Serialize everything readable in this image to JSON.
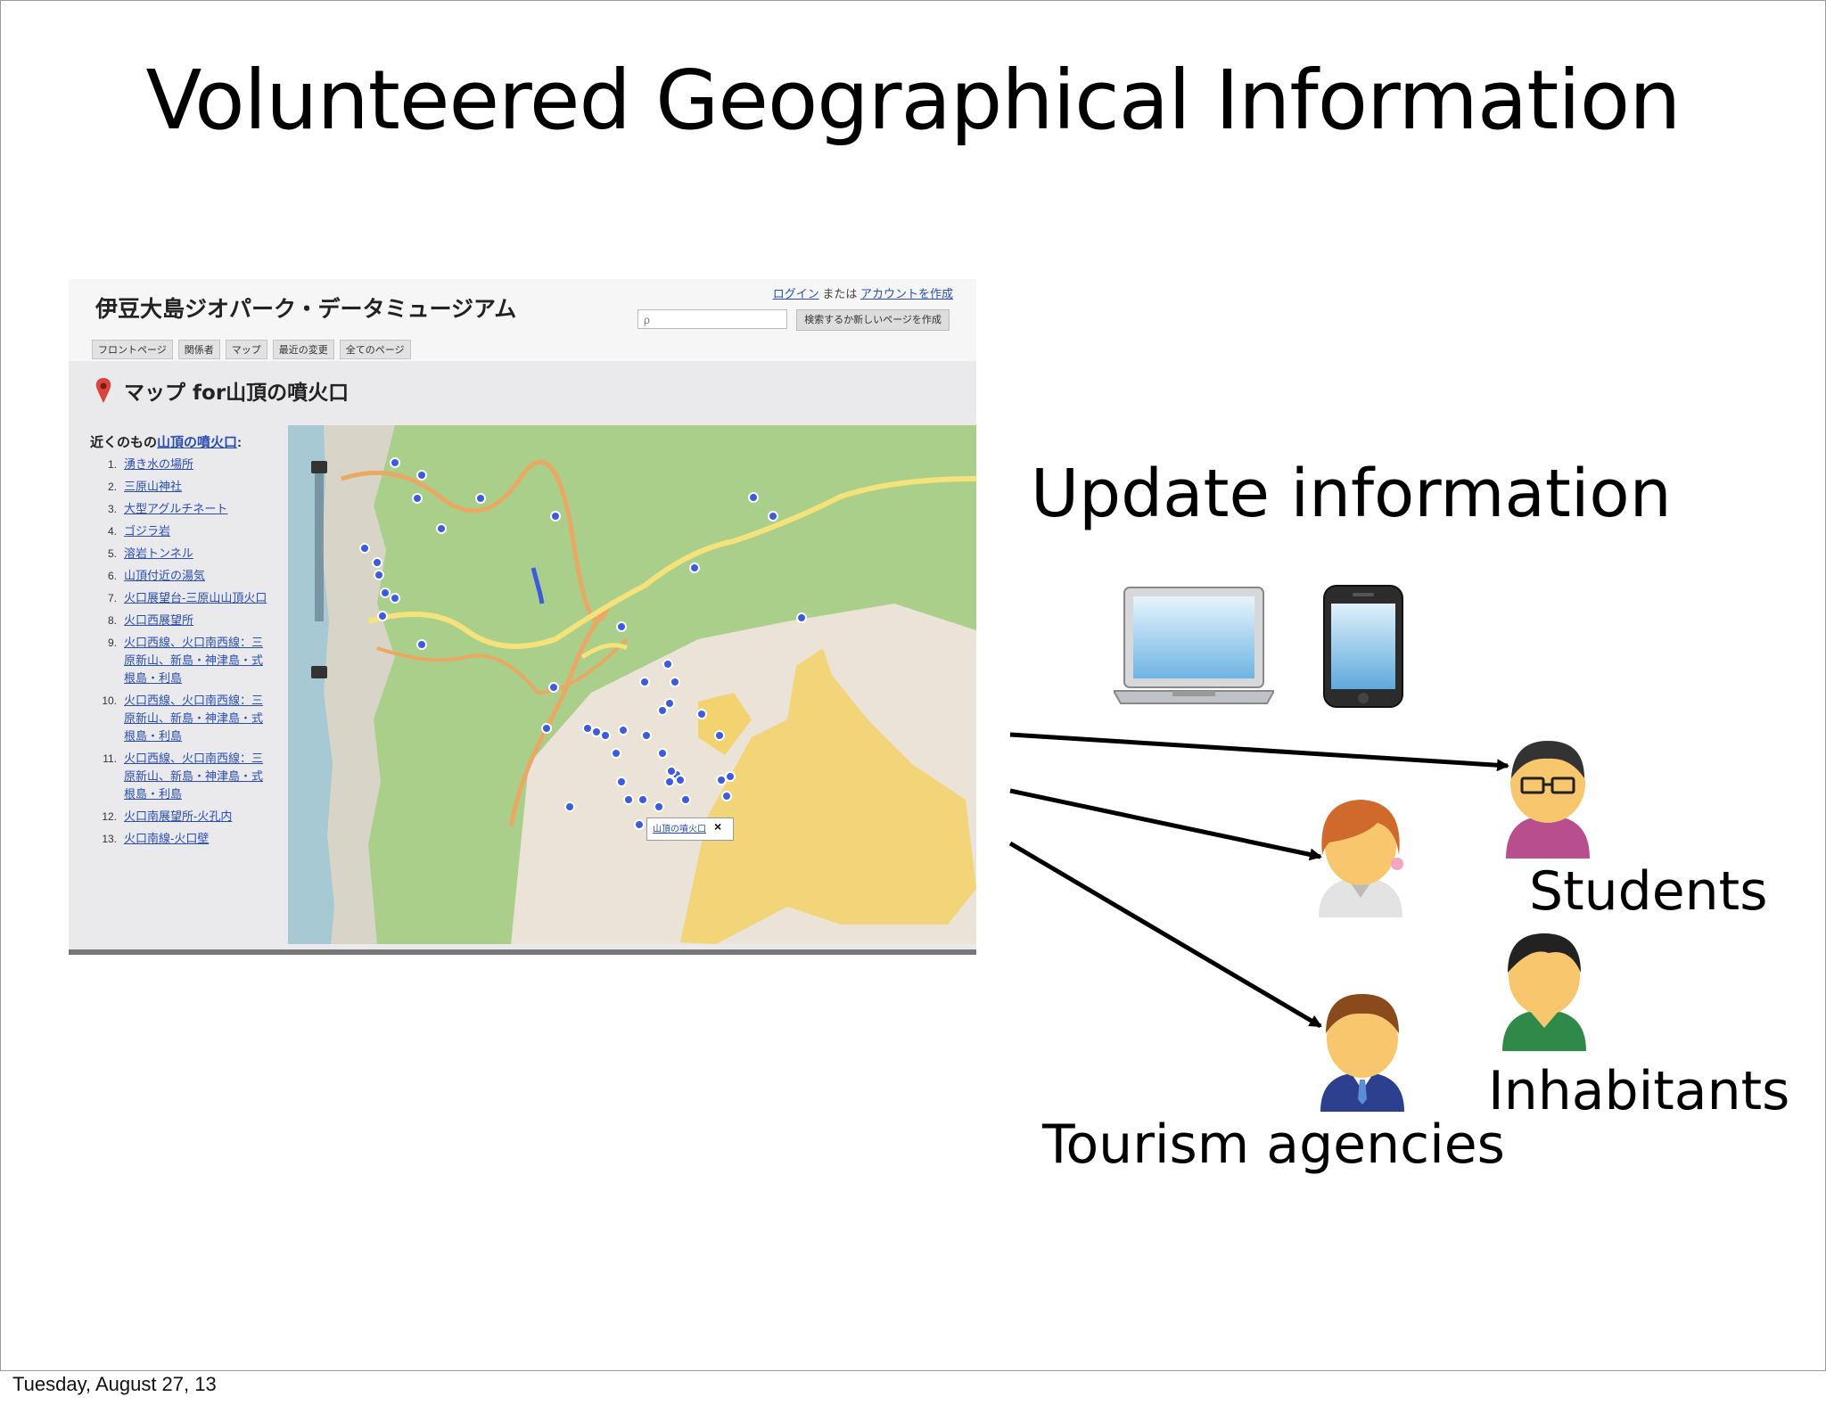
{
  "slide": {
    "title": "Volunteered Geographical Information",
    "footer_date": "Tuesday, August 27, 13"
  },
  "screenshot": {
    "wiki_title": "伊豆大島ジオパーク・データミュージアム",
    "login_link": "ログイン",
    "login_or": "または",
    "create_account_link": "アカウントを作成",
    "search_placeholder": "ρ",
    "search_button": "検索するか新しいページを作成",
    "nav_tabs": [
      "フロントページ",
      "関係者",
      "マップ",
      "最近の変更",
      "全てのページ"
    ],
    "page_heading": "マップ for山頂の噴火口",
    "nearby_prefix": "近くのもの",
    "nearby_link": "山頂の噴火口",
    "nearby_suffix": ":",
    "nearby_items": [
      {
        "num": "1.",
        "label": "湧き水の場所"
      },
      {
        "num": "2.",
        "label": "三原山神社"
      },
      {
        "num": "3.",
        "label": "大型アグルチネート"
      },
      {
        "num": "4.",
        "label": "ゴジラ岩"
      },
      {
        "num": "5.",
        "label": "溶岩トンネル"
      },
      {
        "num": "6.",
        "label": "山頂付近の湯気"
      },
      {
        "num": "7.",
        "label": "火口展望台-三原山山頂火口"
      },
      {
        "num": "8.",
        "label": "火口西展望所"
      },
      {
        "num": "9.",
        "label": "火口西線、火口南西線：三原新山、新島・神津島・式根島・利島"
      },
      {
        "num": "10.",
        "label": "火口西線、火口南西線：三原新山、新島・神津島・式根島・利島"
      },
      {
        "num": "11.",
        "label": "火口西線、火口南西線：三原新山、新島・神津島・式根島・利島"
      },
      {
        "num": "12.",
        "label": "火口南展望所-火孔内"
      },
      {
        "num": "13.",
        "label": "火口南線-火口壁"
      }
    ],
    "map_popup_label": "山頂の噴火口",
    "map_popup_close": "×"
  },
  "diagram": {
    "update_label": "Update information",
    "students_label": "Students",
    "inhabitants_label": "Inhabitants",
    "tourism_label": "Tourism agencies",
    "devices": [
      "laptop-icon",
      "smartphone-icon"
    ],
    "people_icons": [
      "student-glasses-icon",
      "student-girl-icon",
      "inhabitant-icon",
      "tourism-agent-icon"
    ]
  },
  "colors": {
    "link": "#2a4db5",
    "map_green": "#a9cf8a",
    "map_road_yellow": "#f5e27a",
    "map_road_orange": "#e9a864",
    "map_marker_blue": "#3d5be0",
    "map_sand": "#ebe3d7",
    "map_sea": "#a6c9d4",
    "crater_yellow": "#f3d36f"
  }
}
